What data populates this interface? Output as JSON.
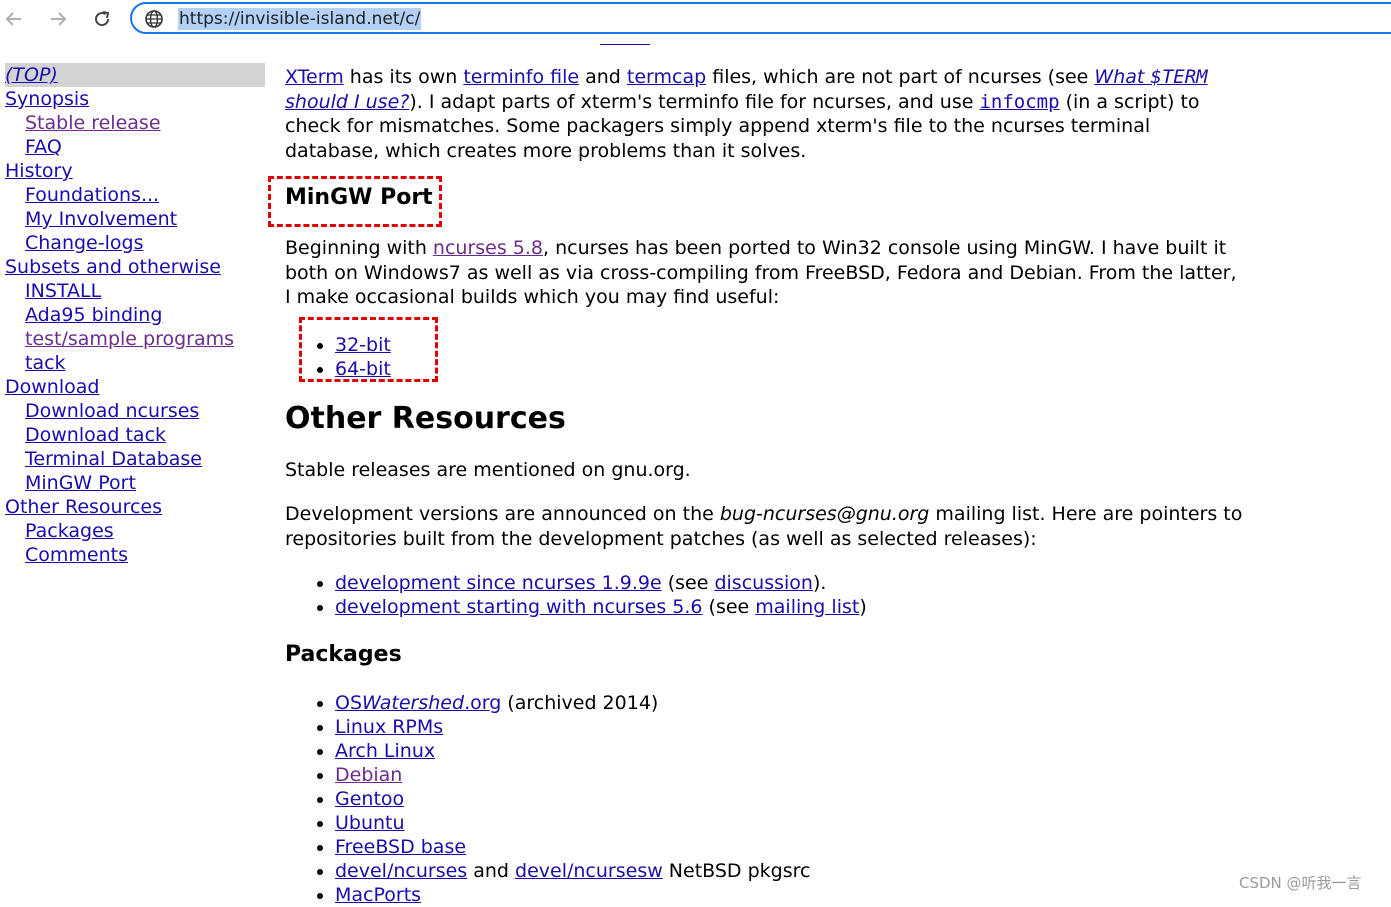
{
  "browser": {
    "url": "https://invisible-island.net/c/",
    "icons": {
      "back": "arrow-left-icon",
      "forward": "arrow-right-icon",
      "reload": "reload-icon",
      "site": "globe-icon"
    }
  },
  "sidebar": {
    "top": "(TOP)",
    "synopsis": "Synopsis",
    "stable_release": "Stable release",
    "faq": "FAQ",
    "history": "History",
    "foundations": "Foundations...",
    "my_involvement": "My Involvement",
    "change_logs": "Change-logs",
    "subsets": "Subsets and otherwise",
    "install": "INSTALL",
    "ada95": "Ada95 binding",
    "test_programs": "test/sample programs",
    "tack": "tack",
    "download": "Download",
    "download_ncurses": "Download ncurses",
    "download_tack": "Download tack",
    "terminal_database": "Terminal Database",
    "mingw_port": "MinGW Port",
    "other_resources": "Other Resources",
    "packages": "Packages",
    "comments": "Comments"
  },
  "intro": {
    "xterm": "XTerm",
    "t1": " has its own ",
    "terminfo_file": "terminfo file",
    "t2": " and ",
    "termcap": "termcap",
    "t3": " files, which are not part of ncurses (see ",
    "what_term_a": "What ",
    "what_term_b": "$TERM",
    "what_term_c": " should I use?",
    "t4": "). I adapt parts of xterm's terminfo file for ncurses, and use ",
    "infocmp": "infocmp",
    "t5": " (in a script) to check for mismatches. Some packagers simply append xterm's file to the ncurses terminal database, which creates more problems than it solves."
  },
  "mingw": {
    "heading": "MinGW Port",
    "t1": "Beginning with ",
    "ncurses58": "ncurses 5.8",
    "t2": ", ncurses has been ported to Win32 console using MinGW. I have built it both on Windows7 as well as via cross-compiling from FreeBSD, Fedora and Debian. From the latter, I make occasional builds which you may find useful:",
    "builds": [
      "32-bit",
      "64-bit"
    ]
  },
  "other": {
    "heading": "Other Resources",
    "stable": "Stable releases are mentioned on gnu.org.",
    "dev_t1": "Development versions are announced on the ",
    "dev_list_name": "bug-ncurses@gnu.org",
    "dev_t2": " mailing list. Here are pointers to repositories built from the development patches (as well as selected releases):",
    "repos": [
      {
        "link": "development since ncurses 1.9.9e",
        "pre": " (see ",
        "link2": "discussion",
        "post": ")."
      },
      {
        "link": "development starting with ncurses 5.6",
        "pre": " (see ",
        "link2": "mailing list",
        "post": ")"
      }
    ]
  },
  "packages": {
    "heading": "Packages",
    "oswatershed_a": "OS",
    "oswatershed_b": "Watershed",
    "oswatershed_c": ".org",
    "oswatershed_note": " (archived 2014)",
    "linux_rpms": "Linux RPMs",
    "arch": "Arch Linux",
    "debian": "Debian",
    "gentoo": "Gentoo",
    "ubuntu": "Ubuntu",
    "freebsd": "FreeBSD base",
    "devel_ncurses": "devel/ncurses",
    "and": " and ",
    "devel_ncursesw": "devel/ncursesw",
    "netbsd_note": " NetBSD pkgsrc",
    "macports": "MacPorts"
  },
  "watermark": "CSDN @听我一言"
}
